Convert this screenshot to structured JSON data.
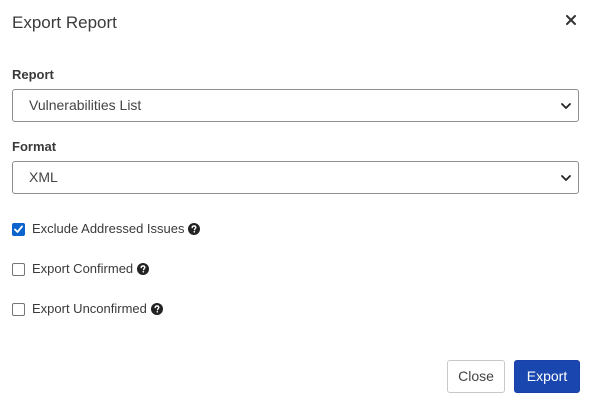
{
  "dialog": {
    "title": "Export Report",
    "close_icon": "close-icon"
  },
  "report": {
    "label": "Report",
    "selected": "Vulnerabilities List"
  },
  "format": {
    "label": "Format",
    "selected": "XML"
  },
  "options": [
    {
      "label": "Exclude Addressed Issues",
      "checked": true
    },
    {
      "label": "Export Confirmed",
      "checked": false
    },
    {
      "label": "Export Unconfirmed",
      "checked": false
    }
  ],
  "buttons": {
    "close_label": "Close",
    "export_label": "Export"
  },
  "colors": {
    "primary": "#1a46b0",
    "checkbox_checked": "#0b63ce"
  }
}
